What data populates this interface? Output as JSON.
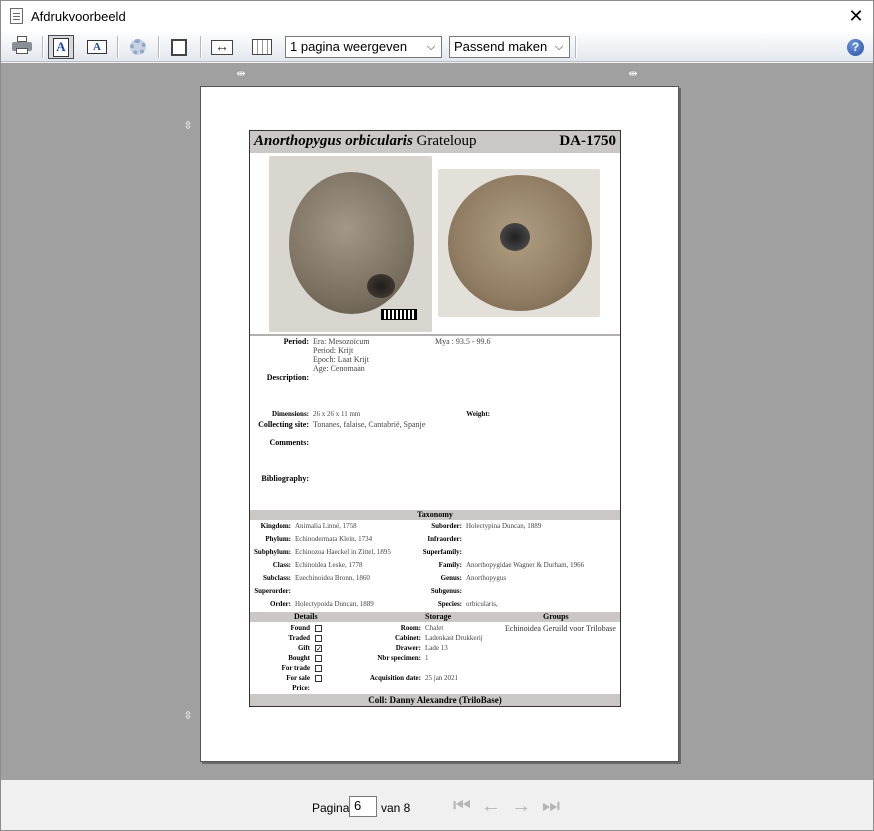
{
  "window": {
    "title": "Afdrukvoorbeeld",
    "close": "✕"
  },
  "toolbar": {
    "page_portrait_glyph": "A",
    "page_landscape_glyph": "A",
    "pages_select": "1 pagina weergeven",
    "zoom_select": "Passend maken",
    "help_glyph": "?",
    "select_arrow": "⌵"
  },
  "card": {
    "species": "Anorthopygus orbicularis",
    "author": "Grateloup",
    "code": "DA-1750",
    "period_label": "Period:",
    "period_lines": [
      "Era: Mesozoïcum",
      "Period: Krijt",
      "Epoch: Laat Krijt",
      "Age: Cenomaan"
    ],
    "mya": "Mya : 93.5 - 99.6",
    "description_label": "Description:",
    "dimensions_label": "Dimensions:",
    "dimensions": "26 x 26 x 11 mm",
    "weight_label": "Weight:",
    "site_label": "Collecting site:",
    "site": "Tonanes, falaise, Cantabrië, Spanje",
    "comments_label": "Comments:",
    "bibliography_label": "Bibliography:",
    "taxonomy_title": "Taxonomy",
    "taxonomy_left": [
      {
        "label": "Kingdom:",
        "value": "Animalia Linné, 1758"
      },
      {
        "label": "Phylum:",
        "value": "Echinodermata Klein, 1734"
      },
      {
        "label": "Subphylum:",
        "value": "Echinozoa Haeckel in Zittel, 1895"
      },
      {
        "label": "Class:",
        "value": "Echinoidea Leske, 1778"
      },
      {
        "label": "Subclass:",
        "value": "Euechinoidea Bronn, 1860"
      },
      {
        "label": "Superorder:",
        "value": ""
      },
      {
        "label": "Order:",
        "value": "Holectypoida Duncan, 1889"
      }
    ],
    "taxonomy_right": [
      {
        "label": "Suborder:",
        "value": "Holectypina Duncan, 1889"
      },
      {
        "label": "Infraorder:",
        "value": ""
      },
      {
        "label": "Superfamily:",
        "value": ""
      },
      {
        "label": "Family:",
        "value": "Anorthopygidae Wagner & Durham, 1966"
      },
      {
        "label": "Genus:",
        "value": "Anorthopygus"
      },
      {
        "label": "Subgenus:",
        "value": ""
      },
      {
        "label": "Species:",
        "value": "orbicularis,"
      }
    ],
    "details_title": "Details",
    "storage_title": "Storage",
    "groups_title": "Groups",
    "details": [
      {
        "label": "Found",
        "checked": ""
      },
      {
        "label": "Traded",
        "checked": ""
      },
      {
        "label": "Gift",
        "checked": "✓"
      },
      {
        "label": "Bought",
        "checked": ""
      },
      {
        "label": "For trade",
        "checked": ""
      },
      {
        "label": "For sale",
        "checked": ""
      },
      {
        "label": "Price:",
        "checked": null
      }
    ],
    "storage": [
      {
        "label": "Room:",
        "value": "Chalet"
      },
      {
        "label": "Cabinet:",
        "value": "Ladenkast Drukkerij"
      },
      {
        "label": "Drawer:",
        "value": "Lade 13"
      },
      {
        "label": "Nbr specimen:",
        "value": "1"
      }
    ],
    "acquisition_label": "Acquisition date:",
    "acquisition_date": "25 jan 2021",
    "groups_value": "Echinoidea Geruild voor Trilobase",
    "footer": "Coll: Danny Alexandre (TriloBase)"
  },
  "pager": {
    "label": "Pagina",
    "current": "6",
    "of": "van 8",
    "first": "⏮",
    "prev": "←",
    "next": "→",
    "last": "⏭"
  }
}
